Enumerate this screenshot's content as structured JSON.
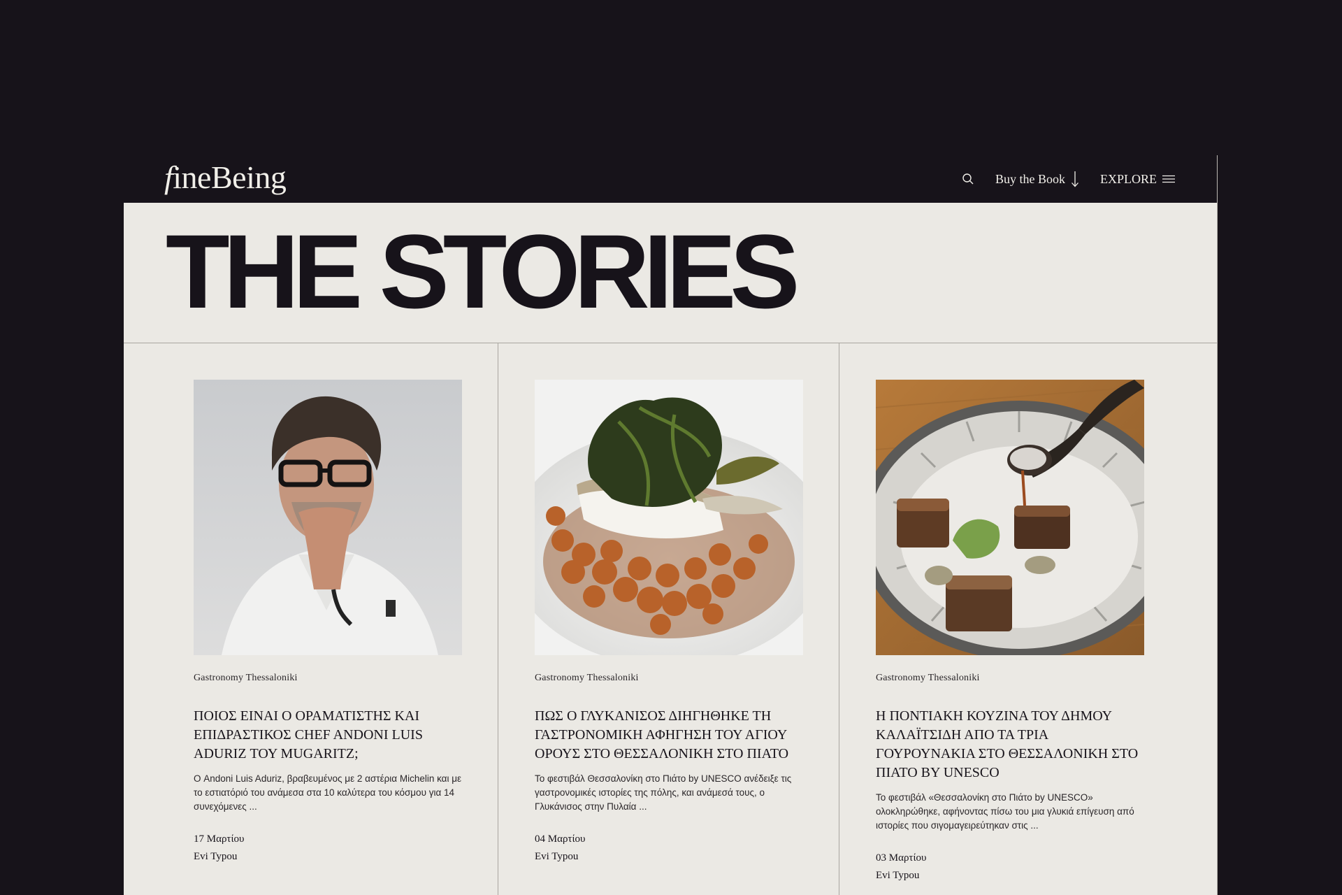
{
  "nav": {
    "logo_first": "f",
    "logo_rest": "ineBeing",
    "buy_label": "Buy the Book",
    "explore_label": "EXPLORE",
    "icons": [
      "search-icon",
      "arrow-down-icon",
      "menu-icon"
    ]
  },
  "hero": {
    "title": "THE STORIES"
  },
  "colors": {
    "dark": "#17131a",
    "paper": "#ebe9e4",
    "text_light": "#f1efe9"
  },
  "stories": [
    {
      "image": "chef-portrait",
      "category": "Gastronomy Thessaloniki",
      "title": "ΠΟΙΟΣ ΕΙΝΑΙ Ο ΟΡΑΜΑΤΙΣΤΗΣ ΚΑΙ ΕΠΙΔΡΑΣΤΙΚΟΣ CHEF ANDONI LUIS ADURIZ ΤΟΥ MUGARITZ;",
      "excerpt": "Ο Andoni Luis Aduriz, βραβευμένος με 2 αστέρια Michelin και με το εστιατόριό του ανάμεσα στα 10 καλύτερα του κόσμου για 14 συνεχόμενες ...",
      "date": "17 Μαρτίου",
      "author": "Evi Typou"
    },
    {
      "image": "fish-chickpeas-dish",
      "category": "Gastronomy Thessaloniki",
      "title": "ΠΩΣ Ο ΓΛΥΚΑΝΙΣΟΣ ΔΙΗΓΗΘΗΚΕ ΤΗ ΓΑΣΤΡΟΝΟΜΙΚΗ ΑΦΗΓΗΣΗ ΤΟΥ ΑΓΙΟΥ ΟΡΟΥΣ ΣΤΟ ΘΕΣΣΑΛΟΝΙΚΗ ΣΤΟ ΠΙΑΤΟ",
      "excerpt": "Το φεστιβάλ Θεσσαλονίκη στο Πιάτο by UNESCO ανέδειξε τις γαστρονομικές ιστορίες της πόλης, και ανάμεσά τους, ο Γλυκάνισος στην Πυλαία ...",
      "date": "04 Μαρτίου",
      "author": "Evi Typou"
    },
    {
      "image": "pork-belly-plate",
      "category": "Gastronomy Thessaloniki",
      "title": "Η ΠΟΝΤΙΑΚΗ ΚΟΥΖΙΝΑ ΤΟΥ ΔΗΜΟΥ ΚΑΛΑΪΤΣΙΔΗ ΑΠΟ ΤΑ ΤΡΙΑ ΓΟΥΡΟΥΝΑΚΙΑ ΣΤΟ ΘΕΣΣΑΛΟΝΙΚΗ ΣΤΟ ΠΙΑΤΟ BY UNESCO",
      "excerpt": "Το φεστιβάλ «Θεσσαλονίκη στο Πιάτο by UNESCO» ολοκληρώθηκε, αφήνοντας πίσω του μια γλυκιά επίγευση από ιστορίες που σιγομαγειρεύτηκαν στις ...",
      "date": "03 Μαρτίου",
      "author": "Evi Typou"
    }
  ]
}
